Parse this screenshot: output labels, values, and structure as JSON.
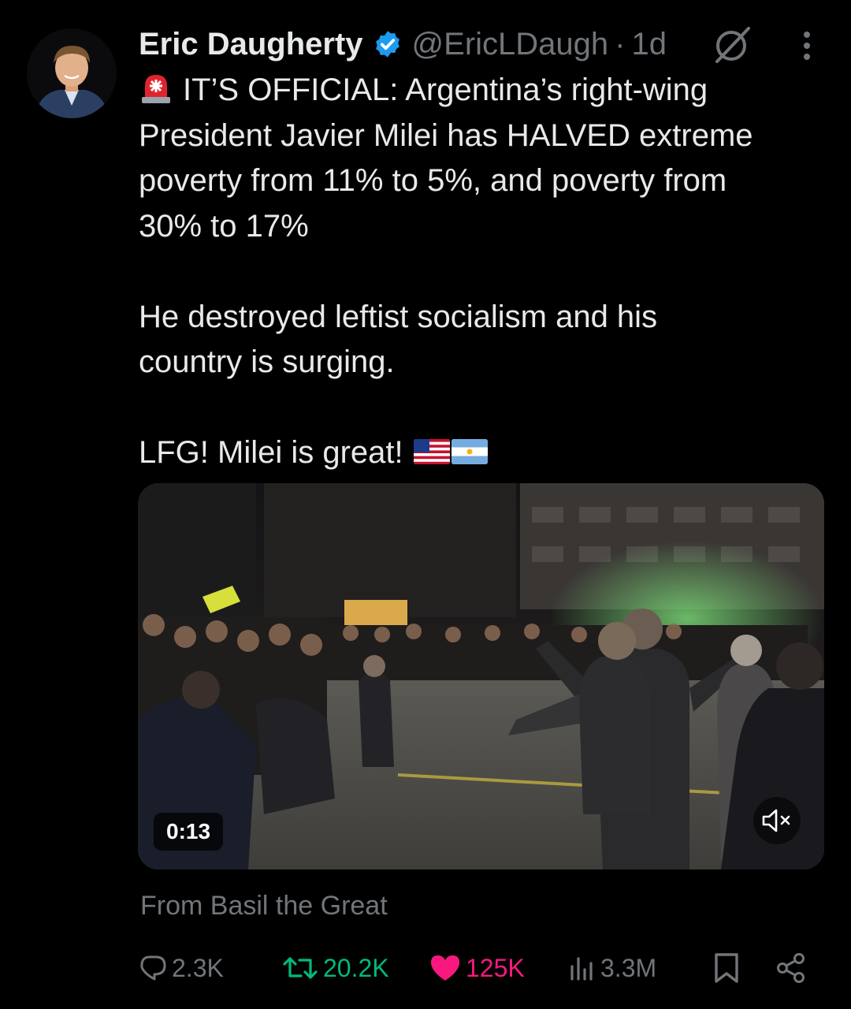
{
  "tweet": {
    "author_name": "Eric Daugherty",
    "handle": "@EricLDaugh",
    "separator": "·",
    "time": "1d",
    "text_lines": [
      "IT’S OFFICIAL: Argentina’s right-wing",
      "President Javier Milei has HALVED extreme",
      "poverty from 11% to 5%, and poverty from",
      "30% to 17%"
    ],
    "paragraph_2_lines": [
      "He destroyed leftist socialism and his",
      "country is surging."
    ],
    "paragraph_3": "LFG! Milei is great!",
    "icons": [
      "verified-badge-icon",
      "grok-icon",
      "more-icon",
      "siren-emoji",
      "us-flag-emoji",
      "argentina-flag-emoji"
    ]
  },
  "media": {
    "duration": "0:13",
    "mute_icon": "speaker-muted-icon"
  },
  "source_text": "From Basil the Great",
  "actions": {
    "replies": "2.3K",
    "reposts": "20.2K",
    "likes": "125K",
    "views": "3.3M"
  },
  "colors": {
    "background": "#000000",
    "text_primary": "#e7e9ea",
    "text_secondary": "#71767b",
    "verified": "#1d9bf0",
    "repost": "#00ba7c",
    "like": "#f91880"
  }
}
